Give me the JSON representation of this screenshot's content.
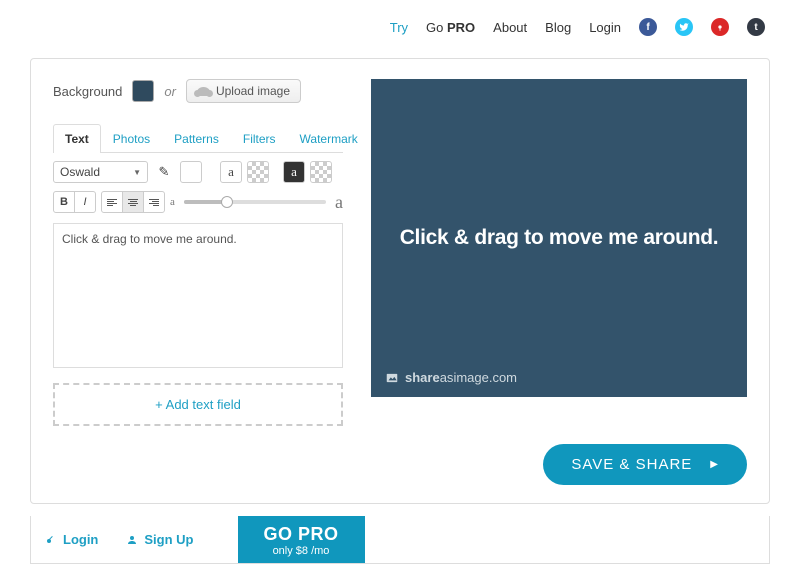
{
  "nav": {
    "try": "Try",
    "gopro_prefix": "Go ",
    "gopro_strong": "PRO",
    "about": "About",
    "blog": "Blog",
    "login": "Login"
  },
  "bg": {
    "label": "Background",
    "color": "#33536b",
    "or": "or",
    "upload": "Upload image"
  },
  "tabs": [
    "Text",
    "Photos",
    "Patterns",
    "Filters",
    "Watermark"
  ],
  "active_tab": "Text",
  "font": {
    "selected": "Oswald"
  },
  "toolbar": {
    "bold": "B",
    "italic": "I",
    "letter_a": "a",
    "size_small": "a",
    "size_large": "a"
  },
  "textarea": {
    "value": "Click & drag to move me around."
  },
  "add_text": "+ Add text field",
  "canvas": {
    "text": "Click & drag to move me around.",
    "brand_bold": "share",
    "brand_mid": "as",
    "brand_rest": "image.com"
  },
  "save": "SAVE & SHARE",
  "bottom": {
    "login": "Login",
    "signup": "Sign Up",
    "gopro": "GO PRO",
    "gopro_sub": "only $8 /mo"
  }
}
